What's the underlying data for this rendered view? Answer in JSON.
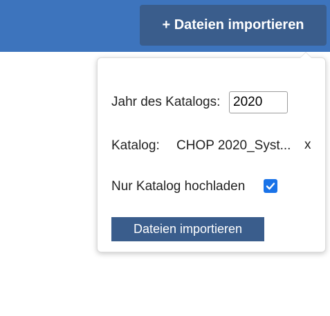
{
  "header": {
    "import_button_label": "+ Dateien importieren",
    "background_color": "#3d74bd",
    "button_color": "#3a5d8c"
  },
  "popover": {
    "year_label": "Jahr des Katalogs:",
    "year_value": "2020",
    "catalog_label": "Katalog:",
    "catalog_value": "CHOP 2020_Syst...",
    "catalog_remove": "x",
    "only_catalog_label": "Nur Katalog hochladen",
    "only_catalog_checked": true,
    "import_button_label": "Dateien importieren",
    "checkbox_color": "#1a73e8"
  }
}
